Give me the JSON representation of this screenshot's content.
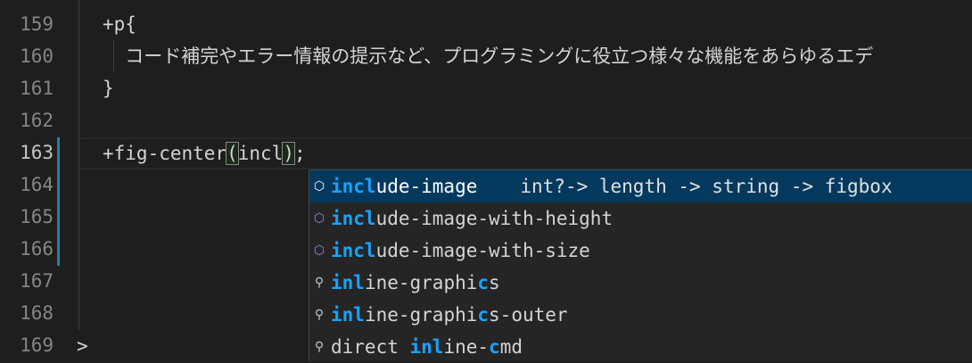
{
  "editor": {
    "lines": [
      {
        "num": "159",
        "text": "+p{"
      },
      {
        "num": "160",
        "text": "  コード補完やエラー情報の提示など、プログラミングに役立つ様々な機能をあらゆるエデ"
      },
      {
        "num": "161",
        "text": "}"
      },
      {
        "num": "162",
        "text": ""
      },
      {
        "num": "163",
        "text": ""
      },
      {
        "num": "164",
        "text": ""
      },
      {
        "num": "165",
        "text": ""
      },
      {
        "num": "166",
        "text": ""
      },
      {
        "num": "167",
        "text": ""
      },
      {
        "num": "168",
        "text": ""
      },
      {
        "num": "169",
        "text": ""
      }
    ],
    "current_line": {
      "before": "+fig-center",
      "open": "(",
      "inner": "incl",
      "close": ")",
      "after": ";"
    },
    "prompt": ">"
  },
  "suggestions": [
    {
      "icon": "cube",
      "selected": true,
      "segments": [
        {
          "t": "incl",
          "h": true
        },
        {
          "t": "ude-image",
          "h": false
        }
      ],
      "detail": "int?-> length -> string -> figbox"
    },
    {
      "icon": "cube",
      "segments": [
        {
          "t": "incl",
          "h": true
        },
        {
          "t": "ude-image-with-height",
          "h": false
        }
      ]
    },
    {
      "icon": "cube",
      "segments": [
        {
          "t": "incl",
          "h": true
        },
        {
          "t": "ude-image-with-size",
          "h": false
        }
      ]
    },
    {
      "icon": "wrench",
      "segments": [
        {
          "t": "inl",
          "h": true
        },
        {
          "t": "ine-graphi",
          "h": false
        },
        {
          "t": "c",
          "h": true
        },
        {
          "t": "s",
          "h": false
        }
      ]
    },
    {
      "icon": "wrench",
      "segments": [
        {
          "t": "inl",
          "h": true
        },
        {
          "t": "ine-graphi",
          "h": false
        },
        {
          "t": "c",
          "h": true
        },
        {
          "t": "s-outer",
          "h": false
        }
      ]
    },
    {
      "icon": "wrench",
      "segments": [
        {
          "t": "direct ",
          "h": false
        },
        {
          "t": "inl",
          "h": true
        },
        {
          "t": "ine-",
          "h": false
        },
        {
          "t": "c",
          "h": true
        },
        {
          "t": "md",
          "h": false
        }
      ]
    }
  ]
}
